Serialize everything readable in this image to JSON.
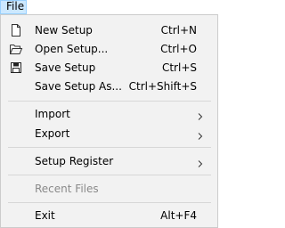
{
  "menubar": {
    "file_label": "File"
  },
  "menu": {
    "new_setup": {
      "label": "New Setup",
      "shortcut": "Ctrl+N",
      "icon": "new-document-icon"
    },
    "open_setup": {
      "label": "Open Setup...",
      "shortcut": "Ctrl+O",
      "icon": "open-folder-icon"
    },
    "save_setup": {
      "label": "Save Setup",
      "shortcut": "Ctrl+S",
      "icon": "floppy-disk-icon"
    },
    "save_setup_as": {
      "label": "Save Setup As...",
      "shortcut": "Ctrl+Shift+S"
    },
    "import": {
      "label": "Import",
      "icon": "chevron-right-icon"
    },
    "export": {
      "label": "Export",
      "icon": "chevron-right-icon"
    },
    "setup_register": {
      "label": "Setup Register",
      "icon": "chevron-right-icon"
    },
    "recent_files": {
      "label": "Recent Files",
      "disabled": true
    },
    "exit": {
      "label": "Exit",
      "shortcut": "Alt+F4"
    }
  },
  "colors": {
    "menubar_highlight": "#cce8ff",
    "menubar_highlight_border": "#99d1ff",
    "menu_background": "#f2f2f2",
    "disabled_text": "#8a8a8a"
  }
}
